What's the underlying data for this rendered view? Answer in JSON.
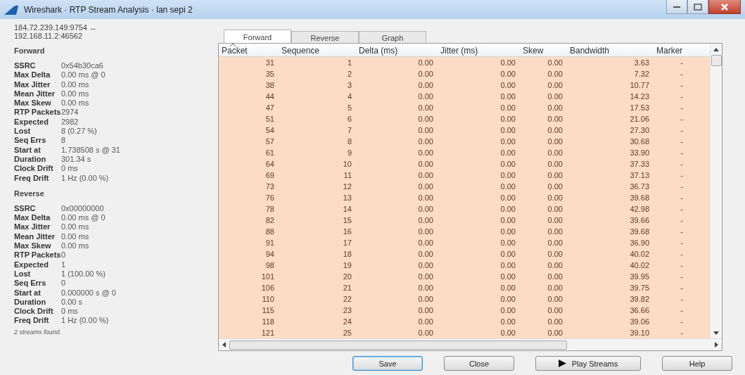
{
  "window": {
    "title": "Wireshark · RTP Stream Analysis · lan sepi 2"
  },
  "stream": {
    "address_line_1": "184.72.239.149:9754 ↔",
    "address_line_2": "192.168.11.2:46562"
  },
  "sections": [
    {
      "heading": "Forward",
      "stats": [
        {
          "label": "SSRC",
          "value": "0x54b30ca6"
        },
        {
          "label": "Max Delta",
          "value": "0.00 ms @ 0"
        },
        {
          "label": "Max Jitter",
          "value": "0.00 ms"
        },
        {
          "label": "Mean Jitter",
          "value": "0.00 ms"
        },
        {
          "label": "Max Skew",
          "value": "0.00 ms"
        },
        {
          "label": "RTP Packets",
          "value": "2974"
        },
        {
          "label": "Expected",
          "value": "2982"
        },
        {
          "label": "Lost",
          "value": "8 (0.27 %)"
        },
        {
          "label": "Seq Errs",
          "value": "8"
        },
        {
          "label": "Start at",
          "value": "1.738508 s @ 31"
        },
        {
          "label": "Duration",
          "value": "301.34 s"
        },
        {
          "label": "Clock Drift",
          "value": "0 ms"
        },
        {
          "label": "Freq Drift",
          "value": "1 Hz (0.00 %)"
        }
      ]
    },
    {
      "heading": "Reverse",
      "stats": [
        {
          "label": "SSRC",
          "value": "0x00000000"
        },
        {
          "label": "Max Delta",
          "value": "0.00 ms @ 0"
        },
        {
          "label": "Max Jitter",
          "value": "0.00 ms"
        },
        {
          "label": "Mean Jitter",
          "value": "0.00 ms"
        },
        {
          "label": "Max Skew",
          "value": "0.00 ms"
        },
        {
          "label": "RTP Packets",
          "value": "0"
        },
        {
          "label": "Expected",
          "value": "1"
        },
        {
          "label": "Lost",
          "value": "1 (100.00 %)"
        },
        {
          "label": "Seq Errs",
          "value": "0"
        },
        {
          "label": "Start at",
          "value": "0.000000 s @ 0"
        },
        {
          "label": "Duration",
          "value": "0.00 s"
        },
        {
          "label": "Clock Drift",
          "value": "0 ms"
        },
        {
          "label": "Freq Drift",
          "value": "1 Hz (0.00 %)"
        }
      ]
    }
  ],
  "streams_found": "2 streams found.",
  "tabs": [
    {
      "label": "Forward",
      "selected": true
    },
    {
      "label": "Reverse",
      "selected": false
    },
    {
      "label": "Graph",
      "selected": false
    }
  ],
  "table": {
    "columns": [
      "Packet",
      "Sequence",
      "Delta (ms)",
      "Jitter (ms)",
      "Skew",
      "Bandwidth",
      "Marker"
    ],
    "rows": [
      [
        "31",
        "1",
        "0.00",
        "0.00",
        "0.00",
        "3.63",
        "-"
      ],
      [
        "35",
        "2",
        "0.00",
        "0.00",
        "0.00",
        "7.32",
        "-"
      ],
      [
        "38",
        "3",
        "0.00",
        "0.00",
        "0.00",
        "10.77",
        "-"
      ],
      [
        "44",
        "4",
        "0.00",
        "0.00",
        "0.00",
        "14.23",
        "-"
      ],
      [
        "47",
        "5",
        "0.00",
        "0.00",
        "0.00",
        "17.53",
        "-"
      ],
      [
        "51",
        "6",
        "0.00",
        "0.00",
        "0.00",
        "21.06",
        "-"
      ],
      [
        "54",
        "7",
        "0.00",
        "0.00",
        "0.00",
        "27.30",
        "-"
      ],
      [
        "57",
        "8",
        "0.00",
        "0.00",
        "0.00",
        "30.68",
        "-"
      ],
      [
        "61",
        "9",
        "0.00",
        "0.00",
        "0.00",
        "33.90",
        "-"
      ],
      [
        "64",
        "10",
        "0.00",
        "0.00",
        "0.00",
        "37.33",
        "-"
      ],
      [
        "69",
        "11",
        "0.00",
        "0.00",
        "0.00",
        "37.13",
        "-"
      ],
      [
        "73",
        "12",
        "0.00",
        "0.00",
        "0.00",
        "36.73",
        "-"
      ],
      [
        "76",
        "13",
        "0.00",
        "0.00",
        "0.00",
        "39.68",
        "-"
      ],
      [
        "78",
        "14",
        "0.00",
        "0.00",
        "0.00",
        "42.98",
        "-"
      ],
      [
        "82",
        "15",
        "0.00",
        "0.00",
        "0.00",
        "39.66",
        "-"
      ],
      [
        "88",
        "16",
        "0.00",
        "0.00",
        "0.00",
        "39.68",
        "-"
      ],
      [
        "91",
        "17",
        "0.00",
        "0.00",
        "0.00",
        "36.90",
        "-"
      ],
      [
        "94",
        "18",
        "0.00",
        "0.00",
        "0.00",
        "40.02",
        "-"
      ],
      [
        "98",
        "19",
        "0.00",
        "0.00",
        "0.00",
        "40.02",
        "-"
      ],
      [
        "101",
        "20",
        "0.00",
        "0.00",
        "0.00",
        "39.95",
        "-"
      ],
      [
        "106",
        "21",
        "0.00",
        "0.00",
        "0.00",
        "39.75",
        "-"
      ],
      [
        "110",
        "22",
        "0.00",
        "0.00",
        "0.00",
        "39.82",
        "-"
      ],
      [
        "115",
        "23",
        "0.00",
        "0.00",
        "0.00",
        "36.66",
        "-"
      ],
      [
        "118",
        "24",
        "0.00",
        "0.00",
        "0.00",
        "39.06",
        "-"
      ],
      [
        "121",
        "25",
        "0.00",
        "0.00",
        "0.00",
        "39.10",
        "-"
      ]
    ]
  },
  "buttons": [
    {
      "label": "Save",
      "kind": "default"
    },
    {
      "label": "Close",
      "kind": "plain"
    },
    {
      "label": "Play Streams",
      "kind": "play"
    },
    {
      "label": "Help",
      "kind": "plain"
    }
  ]
}
